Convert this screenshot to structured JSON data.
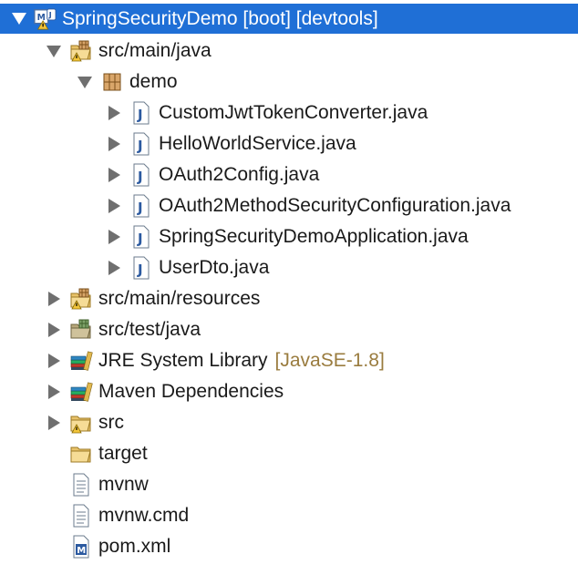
{
  "tree": {
    "project": {
      "label": "SpringSecurityDemo [boot] [devtools]"
    },
    "src_main_java": {
      "label": "src/main/java"
    },
    "package_demo": {
      "label": "demo"
    },
    "files": [
      {
        "label": "CustomJwtTokenConverter.java"
      },
      {
        "label": "HelloWorldService.java"
      },
      {
        "label": "OAuth2Config.java"
      },
      {
        "label": "OAuth2MethodSecurityConfiguration.java"
      },
      {
        "label": "SpringSecurityDemoApplication.java"
      },
      {
        "label": "UserDto.java"
      }
    ],
    "src_main_resources": {
      "label": "src/main/resources"
    },
    "src_test_java": {
      "label": "src/test/java"
    },
    "jre": {
      "label": "JRE System Library",
      "decoration": "[JavaSE-1.8]"
    },
    "maven": {
      "label": "Maven Dependencies"
    },
    "src": {
      "label": "src"
    },
    "target": {
      "label": "target"
    },
    "mvnw": {
      "label": "mvnw"
    },
    "mvnw_cmd": {
      "label": "mvnw.cmd"
    },
    "pom": {
      "label": "pom.xml"
    }
  },
  "colors": {
    "selection": "#1f6fd6",
    "decoration": "#9a7c3f",
    "folder": "#e8c26a",
    "java_badge": "#2c5aa0"
  },
  "icons": {
    "project": "maven-project-icon",
    "source_folder": "source-folder-icon",
    "package": "package-icon",
    "java_file": "java-file-icon",
    "library": "library-icon",
    "folder": "folder-icon",
    "text_file": "text-file-icon",
    "pom_file": "maven-pom-icon"
  }
}
